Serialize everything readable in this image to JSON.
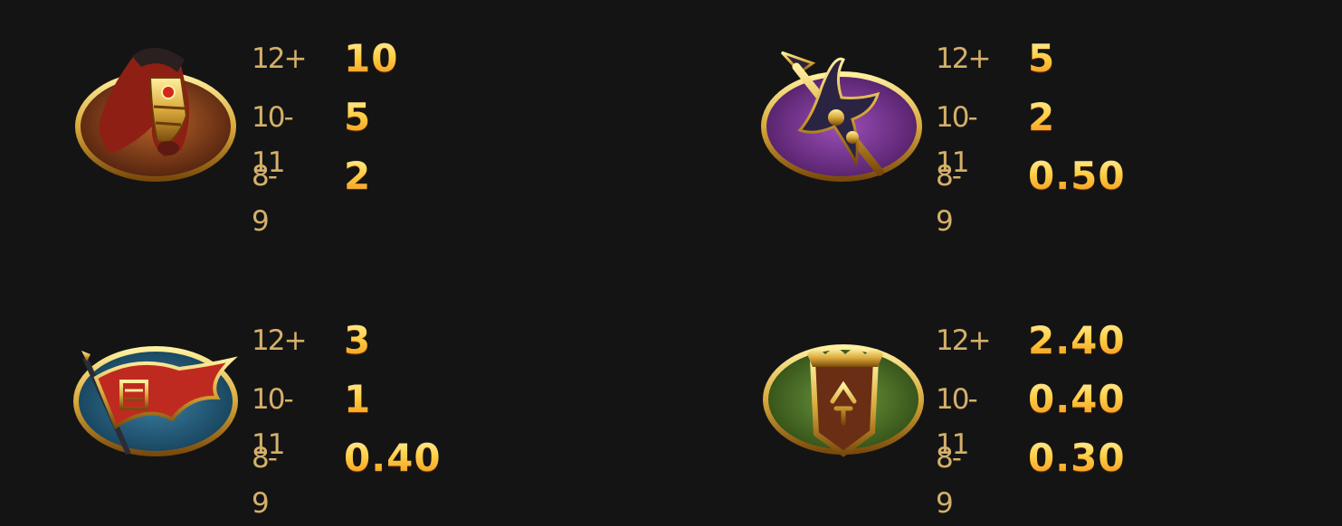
{
  "paytable": {
    "symbols": [
      {
        "id": "horse",
        "icon": "horse-icon",
        "rows": [
          {
            "count": "12+",
            "payout": "10"
          },
          {
            "count": "10-11",
            "payout": "5"
          },
          {
            "count": "8-9",
            "payout": "2"
          }
        ]
      },
      {
        "id": "halberd",
        "icon": "halberd-icon",
        "rows": [
          {
            "count": "12+",
            "payout": "5"
          },
          {
            "count": "10-11",
            "payout": "2"
          },
          {
            "count": "8-9",
            "payout": "0.50"
          }
        ]
      },
      {
        "id": "banner",
        "icon": "war-banner-icon",
        "rows": [
          {
            "count": "12+",
            "payout": "3"
          },
          {
            "count": "10-11",
            "payout": "1"
          },
          {
            "count": "8-9",
            "payout": "0.40"
          }
        ]
      },
      {
        "id": "token",
        "icon": "command-token-icon",
        "rows": [
          {
            "count": "12+",
            "payout": "2.40"
          },
          {
            "count": "10-11",
            "payout": "0.40"
          },
          {
            "count": "8-9",
            "payout": "0.30"
          }
        ]
      }
    ]
  },
  "colors": {
    "background": "#151414",
    "count_text": "#d4b06a",
    "payout_gold": "#ffcf45",
    "frame_gold": "#d9a93a"
  }
}
